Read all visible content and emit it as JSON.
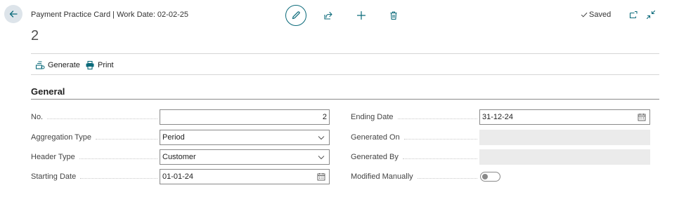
{
  "header": {
    "caption": "Payment Practice Card | Work Date: 02-02-25",
    "record_no": "2",
    "saved_label": "Saved"
  },
  "actions": {
    "generate_label": "Generate",
    "print_label": "Print"
  },
  "general": {
    "title": "General",
    "no": {
      "label": "No.",
      "value": "2"
    },
    "aggregation_type": {
      "label": "Aggregation Type",
      "value": "Period"
    },
    "header_type": {
      "label": "Header Type",
      "value": "Customer"
    },
    "starting_date": {
      "label": "Starting Date",
      "value": "01-01-24"
    },
    "ending_date": {
      "label": "Ending Date",
      "value": "31-12-24"
    },
    "generated_on": {
      "label": "Generated On",
      "value": ""
    },
    "generated_by": {
      "label": "Generated By",
      "value": ""
    },
    "modified_manually": {
      "label": "Modified Manually",
      "value": false
    }
  },
  "colors": {
    "accent": "#0b6a7a",
    "back_button_bg": "#dde4ea",
    "disabled_field_bg": "#ebebeb"
  },
  "icons": [
    "arrow-left-icon",
    "pencil-icon",
    "share-icon",
    "plus-icon",
    "trash-icon",
    "checkmark-icon",
    "open-new-window-icon",
    "collapse-icon",
    "generate-icon",
    "printer-icon",
    "calendar-icon",
    "chevron-down-icon"
  ]
}
